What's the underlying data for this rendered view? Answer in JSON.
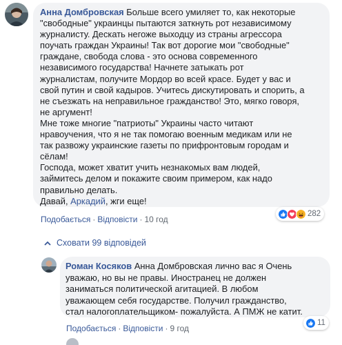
{
  "comment": {
    "author": "Анна Домбровская",
    "text_before_mention": " Больше всего умиляет то, как некоторые \n\"свободные\" украинцы пытаются заткнуть рот независимому \nжурналисту. Дескать негоже выходцу из страны агрессора \nпоучать граждан Украины! Так вот дорогие мои \"свободные\" \nграждане, свобода слова - это основа современного \nнезависимого государства! Начнете затыкать рот \nжурналистам, получите Мордор во всей красе. Будет у вас и \nсвой путин и свой кадыров. Учитесь дискутировать и спорить, а \nне съезжать на неправильное гражданство! Это, мягко говоря, \nне аргумент!\nМне тоже многие \"патриоты\" Украины часто читают \nнравоучения, что я не так помогаю военным медикам или не \nтак развожу украинские газеты по прифронтовым городам и \nсёлам!\nГоспода, может хватит учить незнакомых вам людей, \nзаймитесь делом и покажите своим примером, как надо \nправильно делать.\nДавай, ",
    "mention": "Аркадий",
    "text_after_mention": ", жги еще!",
    "reaction_count": "282",
    "reaction_icons": [
      "like-icon",
      "love-icon",
      "haha-icon"
    ],
    "like_label": "Подобається",
    "reply_label": "Відповісти",
    "time": "10 год"
  },
  "view_replies": {
    "label": "Сховати 99 відповідей"
  },
  "reply": {
    "author": "Роман Косяков",
    "text": " Анна Домбровская лично вас я Очень \nуважаю, но вы не правы. Иностранец не должен \nзаниматься политической агитацией. В любом \nуважающем себя государстве. Получил гражданство, \nстал налогоплательщиком- пожалуйста. А ПМЖ не катит.",
    "reaction_count": "11",
    "reaction_icons": [
      "like-icon"
    ],
    "like_label": "Подобається",
    "reply_label": "Відповісти",
    "time": "9 год"
  },
  "colors": {
    "link": "#385898",
    "bubble": "#f2f3f5",
    "meta": "#606770",
    "like": "#1877f2",
    "love": "#f33e58",
    "haha": "#f7b125"
  }
}
